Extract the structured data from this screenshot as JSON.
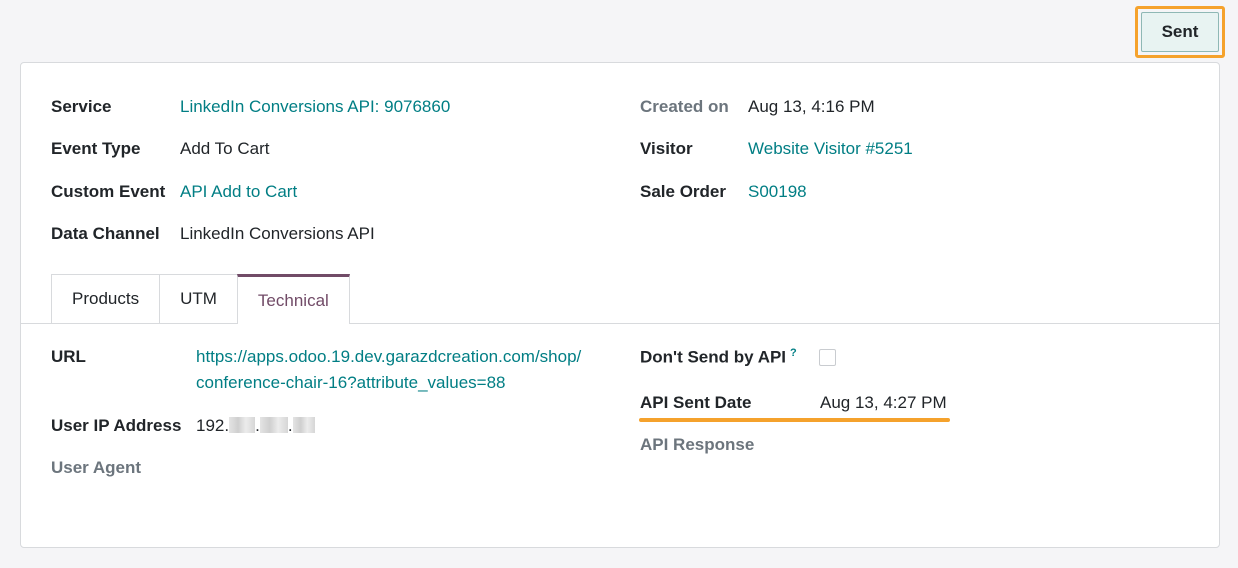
{
  "status_button": {
    "label": "Sent"
  },
  "fields_left": [
    {
      "label": "Service",
      "value": "LinkedIn Conversions API: 9076860"
    },
    {
      "label": "Event Type",
      "value": "Add To Cart"
    },
    {
      "label": "Custom Event",
      "value": "API Add to Cart"
    },
    {
      "label": "Data Channel",
      "value": "LinkedIn Conversions API"
    }
  ],
  "fields_right": [
    {
      "label": "Created on",
      "value": "Aug 13, 4:16 PM"
    },
    {
      "label": "Visitor",
      "value": "Website Visitor #5251"
    },
    {
      "label": "Sale Order",
      "value": "S00198"
    }
  ],
  "tabs": [
    {
      "label": "Products",
      "active": false
    },
    {
      "label": "UTM",
      "active": false
    },
    {
      "label": "Technical",
      "active": true
    }
  ],
  "technical": {
    "url_label": "URL",
    "url_line1": "https://apps.odoo.19.dev.garazdcreation.com/shop/",
    "url_line2": "conference-chair-16?attribute_values=88",
    "ip_label": "User IP Address",
    "ip_prefix": "192.",
    "ip_dot": ".",
    "user_agent_label": "User Agent",
    "dont_send_label": "Don't Send by API",
    "help_mark": "?",
    "dont_send_checked": false,
    "api_sent_date_label": "API Sent Date",
    "api_sent_date_value": "Aug 13, 4:27 PM",
    "api_response_label": "API Response"
  },
  "colors": {
    "accent_link": "#017e84",
    "tab_active": "#714b67",
    "highlight": "#f5a22c"
  }
}
